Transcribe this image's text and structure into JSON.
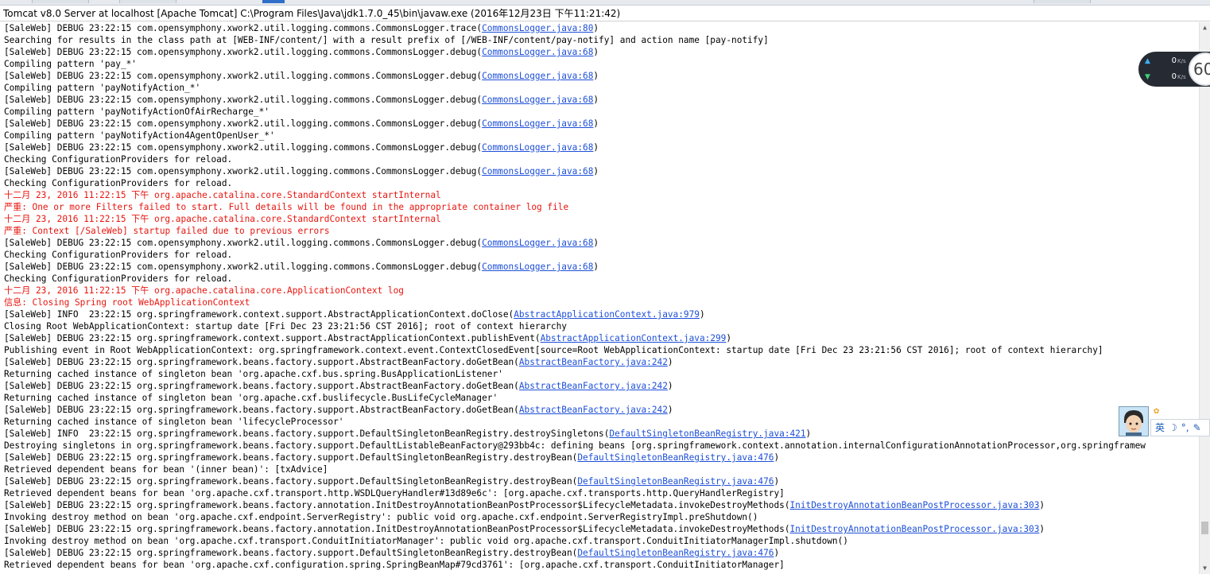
{
  "window": {
    "title": "Tomcat v8.0 Server at localhost [Apache Tomcat] C:\\Program Files\\Java\\jdk1.7.0_45\\bin\\javaw.exe (2016年12月23日 下午11:21:42)"
  },
  "console": {
    "lines": [
      {
        "t": "[SaleWeb] DEBUG 23:22:15 com.opensymphony.xwork2.util.logging.commons.CommonsLogger.trace(",
        "l": "CommonsLogger.java:80",
        "s": ")"
      },
      {
        "t": "Searching for results in the class path at [WEB-INF/content/] with a result prefix of [/WEB-INF/content/pay-notify] and action name [pay-notify]"
      },
      {
        "t": "[SaleWeb] DEBUG 23:22:15 com.opensymphony.xwork2.util.logging.commons.CommonsLogger.debug(",
        "l": "CommonsLogger.java:68",
        "s": ")"
      },
      {
        "t": "Compiling pattern 'pay_*'"
      },
      {
        "t": "[SaleWeb] DEBUG 23:22:15 com.opensymphony.xwork2.util.logging.commons.CommonsLogger.debug(",
        "l": "CommonsLogger.java:68",
        "s": ")"
      },
      {
        "t": "Compiling pattern 'payNotifyAction_*'"
      },
      {
        "t": "[SaleWeb] DEBUG 23:22:15 com.opensymphony.xwork2.util.logging.commons.CommonsLogger.debug(",
        "l": "CommonsLogger.java:68",
        "s": ")"
      },
      {
        "t": "Compiling pattern 'payNotifyActionOfAirRecharge_*'"
      },
      {
        "t": "[SaleWeb] DEBUG 23:22:15 com.opensymphony.xwork2.util.logging.commons.CommonsLogger.debug(",
        "l": "CommonsLogger.java:68",
        "s": ")"
      },
      {
        "t": "Compiling pattern 'payNotifyAction4AgentOpenUser_*'"
      },
      {
        "t": "[SaleWeb] DEBUG 23:22:15 com.opensymphony.xwork2.util.logging.commons.CommonsLogger.debug(",
        "l": "CommonsLogger.java:68",
        "s": ")"
      },
      {
        "t": "Checking ConfigurationProviders for reload."
      },
      {
        "t": "[SaleWeb] DEBUG 23:22:15 com.opensymphony.xwork2.util.logging.commons.CommonsLogger.debug(",
        "l": "CommonsLogger.java:68",
        "s": ")"
      },
      {
        "t": "Checking ConfigurationProviders for reload."
      },
      {
        "t": "十二月 23, 2016 11:22:15 下午 org.apache.catalina.core.StandardContext startInternal",
        "e": true
      },
      {
        "t": "严重: One or more Filters failed to start. Full details will be found in the appropriate container log file",
        "e": true
      },
      {
        "t": "十二月 23, 2016 11:22:15 下午 org.apache.catalina.core.StandardContext startInternal",
        "e": true
      },
      {
        "t": "严重: Context [/SaleWeb] startup failed due to previous errors",
        "e": true
      },
      {
        "t": "[SaleWeb] DEBUG 23:22:15 com.opensymphony.xwork2.util.logging.commons.CommonsLogger.debug(",
        "l": "CommonsLogger.java:68",
        "s": ")"
      },
      {
        "t": "Checking ConfigurationProviders for reload."
      },
      {
        "t": "[SaleWeb] DEBUG 23:22:15 com.opensymphony.xwork2.util.logging.commons.CommonsLogger.debug(",
        "l": "CommonsLogger.java:68",
        "s": ")"
      },
      {
        "t": "Checking ConfigurationProviders for reload."
      },
      {
        "t": "十二月 23, 2016 11:22:15 下午 org.apache.catalina.core.ApplicationContext log",
        "e": true
      },
      {
        "t": "信息: Closing Spring root WebApplicationContext",
        "e": true
      },
      {
        "t": "[SaleWeb] INFO  23:22:15 org.springframework.context.support.AbstractApplicationContext.doClose(",
        "l": "AbstractApplicationContext.java:979",
        "s": ")"
      },
      {
        "t": "Closing Root WebApplicationContext: startup date [Fri Dec 23 23:21:56 CST 2016]; root of context hierarchy"
      },
      {
        "t": "[SaleWeb] DEBUG 23:22:15 org.springframework.context.support.AbstractApplicationContext.publishEvent(",
        "l": "AbstractApplicationContext.java:299",
        "s": ")"
      },
      {
        "t": "Publishing event in Root WebApplicationContext: org.springframework.context.event.ContextClosedEvent[source=Root WebApplicationContext: startup date [Fri Dec 23 23:21:56 CST 2016]; root of context hierarchy]"
      },
      {
        "t": "[SaleWeb] DEBUG 23:22:15 org.springframework.beans.factory.support.AbstractBeanFactory.doGetBean(",
        "l": "AbstractBeanFactory.java:242",
        "s": ")"
      },
      {
        "t": "Returning cached instance of singleton bean 'org.apache.cxf.bus.spring.BusApplicationListener'"
      },
      {
        "t": "[SaleWeb] DEBUG 23:22:15 org.springframework.beans.factory.support.AbstractBeanFactory.doGetBean(",
        "l": "AbstractBeanFactory.java:242",
        "s": ")"
      },
      {
        "t": "Returning cached instance of singleton bean 'org.apache.cxf.buslifecycle.BusLifeCycleManager'"
      },
      {
        "t": "[SaleWeb] DEBUG 23:22:15 org.springframework.beans.factory.support.AbstractBeanFactory.doGetBean(",
        "l": "AbstractBeanFactory.java:242",
        "s": ")"
      },
      {
        "t": "Returning cached instance of singleton bean 'lifecycleProcessor'"
      },
      {
        "t": "[SaleWeb] INFO  23:22:15 org.springframework.beans.factory.support.DefaultSingletonBeanRegistry.destroySingletons(",
        "l": "DefaultSingletonBeanRegistry.java:421",
        "s": ")"
      },
      {
        "t": "Destroying singletons in org.springframework.beans.factory.support.DefaultListableBeanFactory@293bb4c: defining beans [org.springframework.context.annotation.internalConfigurationAnnotationProcessor,org.springframew"
      },
      {
        "t": "[SaleWeb] DEBUG 23:22:15 org.springframework.beans.factory.support.DefaultSingletonBeanRegistry.destroyBean(",
        "l": "DefaultSingletonBeanRegistry.java:476",
        "s": ")"
      },
      {
        "t": "Retrieved dependent beans for bean '(inner bean)': [txAdvice]"
      },
      {
        "t": "[SaleWeb] DEBUG 23:22:15 org.springframework.beans.factory.support.DefaultSingletonBeanRegistry.destroyBean(",
        "l": "DefaultSingletonBeanRegistry.java:476",
        "s": ")"
      },
      {
        "t": "Retrieved dependent beans for bean 'org.apache.cxf.transport.http.WSDLQueryHandler#13d89e6c': [org.apache.cxf.transports.http.QueryHandlerRegistry]"
      },
      {
        "t": "[SaleWeb] DEBUG 23:22:15 org.springframework.beans.factory.annotation.InitDestroyAnnotationBeanPostProcessor$LifecycleMetadata.invokeDestroyMethods(",
        "l": "InitDestroyAnnotationBeanPostProcessor.java:303",
        "s": ")"
      },
      {
        "t": "Invoking destroy method on bean 'org.apache.cxf.endpoint.ServerRegistry': public void org.apache.cxf.endpoint.ServerRegistryImpl.preShutdown()"
      },
      {
        "t": "[SaleWeb] DEBUG 23:22:15 org.springframework.beans.factory.annotation.InitDestroyAnnotationBeanPostProcessor$LifecycleMetadata.invokeDestroyMethods(",
        "l": "InitDestroyAnnotationBeanPostProcessor.java:303",
        "s": ")"
      },
      {
        "t": "Invoking destroy method on bean 'org.apache.cxf.transport.ConduitInitiatorManager': public void org.apache.cxf.transport.ConduitInitiatorManagerImpl.shutdown()"
      },
      {
        "t": "[SaleWeb] DEBUG 23:22:15 org.springframework.beans.factory.support.DefaultSingletonBeanRegistry.destroyBean(",
        "l": "DefaultSingletonBeanRegistry.java:476",
        "s": ")"
      },
      {
        "t": "Retrieved dependent beans for bean 'org.apache.cxf.configuration.spring.SpringBeanMap#79cd3761': [org.apache.cxf.transport.ConduitInitiatorManager]"
      }
    ]
  },
  "net_widget": {
    "upload_value": "0",
    "upload_unit": "K/s",
    "download_value": "0",
    "download_unit": "K/s",
    "gauge_text": "60"
  },
  "ime_toolbar": {
    "lang_label": "英",
    "moon_glyph": "☽",
    "punct_glyph": "°,",
    "tool_glyph": "✎"
  },
  "colors": {
    "error_text": "#e8150e",
    "link_text": "#1d4fd8",
    "active_tab": "#2f6fc9"
  }
}
